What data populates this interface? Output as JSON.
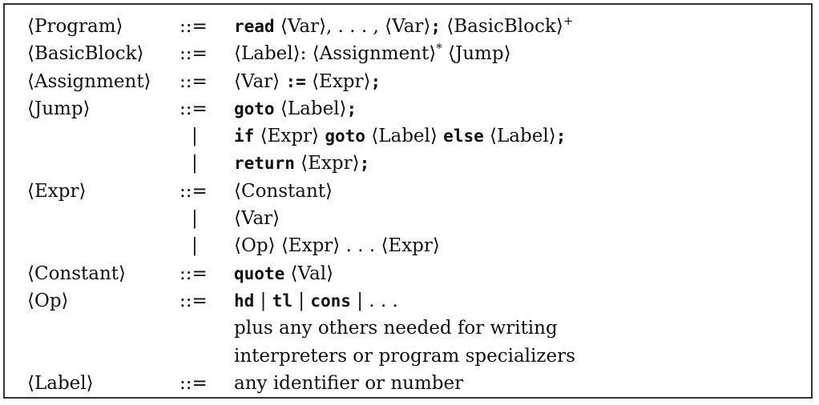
{
  "grammar": {
    "rows": [
      {
        "lhs": "⟨Program⟩",
        "op": "::=",
        "rhs": [
          {
            "t": "read",
            "k": "kw"
          },
          {
            "t": " ⟨Var⟩, . . . , ⟨Var⟩"
          },
          {
            "t": ";",
            "k": "kw"
          },
          {
            "t": " ⟨BasicBlock⟩"
          },
          {
            "t": "+",
            "k": "sup"
          }
        ]
      },
      {
        "lhs": "⟨BasicBlock⟩",
        "op": "::=",
        "rhs": [
          {
            "t": "⟨Label⟩: ⟨Assignment⟩"
          },
          {
            "t": "*",
            "k": "sup"
          },
          {
            "t": " ⟨Jump⟩"
          }
        ]
      },
      {
        "lhs": "⟨Assignment⟩",
        "op": "::=",
        "rhs": [
          {
            "t": "⟨Var⟩ "
          },
          {
            "t": ":=",
            "k": "kw"
          },
          {
            "t": " ⟨Expr⟩"
          },
          {
            "t": ";",
            "k": "kw"
          }
        ]
      },
      {
        "lhs": "⟨Jump⟩",
        "op": "::=",
        "rhs": [
          {
            "t": "goto",
            "k": "kw"
          },
          {
            "t": " ⟨Label⟩"
          },
          {
            "t": ";",
            "k": "kw"
          }
        ]
      },
      {
        "lhs": "",
        "op": "|",
        "rhs": [
          {
            "t": "if",
            "k": "kw"
          },
          {
            "t": " ⟨Expr⟩ "
          },
          {
            "t": "goto",
            "k": "kw"
          },
          {
            "t": " ⟨Label⟩ "
          },
          {
            "t": "else",
            "k": "kw"
          },
          {
            "t": " ⟨Label⟩"
          },
          {
            "t": ";",
            "k": "kw"
          }
        ]
      },
      {
        "lhs": "",
        "op": "|",
        "rhs": [
          {
            "t": "return",
            "k": "kw"
          },
          {
            "t": " ⟨Expr⟩"
          },
          {
            "t": ";",
            "k": "kw"
          }
        ]
      },
      {
        "lhs": "⟨Expr⟩",
        "op": "::=",
        "rhs": [
          {
            "t": "⟨Constant⟩"
          }
        ]
      },
      {
        "lhs": "",
        "op": "|",
        "rhs": [
          {
            "t": "⟨Var⟩"
          }
        ]
      },
      {
        "lhs": "",
        "op": "|",
        "rhs": [
          {
            "t": "⟨Op⟩ ⟨Expr⟩ . . . ⟨Expr⟩"
          }
        ]
      },
      {
        "lhs": "⟨Constant⟩",
        "op": "::=",
        "rhs": [
          {
            "t": "quote",
            "k": "kw"
          },
          {
            "t": " ⟨Val⟩"
          }
        ]
      },
      {
        "lhs": "⟨Op⟩",
        "op": "::=",
        "rhs": [
          {
            "t": "hd",
            "k": "kw"
          },
          {
            "t": " | "
          },
          {
            "t": "tl",
            "k": "kw"
          },
          {
            "t": " | "
          },
          {
            "t": "cons",
            "k": "kw"
          },
          {
            "t": " | . . ."
          }
        ]
      },
      {
        "lhs": "",
        "op": "",
        "rhs": [
          {
            "t": "plus any others needed for writing"
          }
        ]
      },
      {
        "lhs": "",
        "op": "",
        "rhs": [
          {
            "t": "interpreters or program specializers"
          }
        ]
      },
      {
        "lhs": "⟨Label⟩",
        "op": "::=",
        "rhs": [
          {
            "t": "any identifier or number"
          }
        ]
      }
    ]
  }
}
